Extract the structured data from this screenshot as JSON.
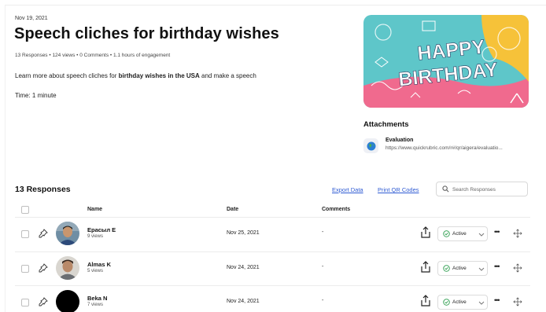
{
  "post": {
    "date": "Nov 19, 2021",
    "title": "Speech cliches for birthday wishes",
    "stats": "13 Responses • 124 views • 0 Comments • 1.1 hours of engagement",
    "desc_prefix": "Learn more about speech cliches for ",
    "desc_bold": "birthday wishes in the USA",
    "desc_suffix": " and make a speech",
    "time": "Time: 1 minute"
  },
  "banner": {
    "line1": "HAPPY",
    "line2": "BIRTHDAY"
  },
  "attachments": {
    "title": "Attachments",
    "items": [
      {
        "name": "Evaluation",
        "url": "https://www.quickrubric.com/r#/qr/aigera/evaluatio...",
        "icon": "globe-icon"
      }
    ]
  },
  "responses": {
    "title": "13 Responses",
    "export_label": "Export Data",
    "print_label": "Print QR Codes",
    "search_placeholder": "Search Responses",
    "columns": {
      "name": "Name",
      "date": "Date",
      "comments": "Comments"
    },
    "rows": [
      {
        "name": "Ерасыл Е",
        "views": "9 views",
        "date": "Nov 25, 2021",
        "comments": "-",
        "status": "Active"
      },
      {
        "name": "Almas K",
        "views": "5 views",
        "date": "Nov 24, 2021",
        "comments": "-",
        "status": "Active"
      },
      {
        "name": "Beka N",
        "views": "7 views",
        "date": "Nov 24, 2021",
        "comments": "-",
        "status": "Active"
      }
    ]
  },
  "colors": {
    "link": "#2f5bd3",
    "active": "#2e9e4f",
    "banner_teal": "#5ec6c9",
    "banner_yellow": "#f6c239",
    "banner_pink": "#f06a8e"
  }
}
